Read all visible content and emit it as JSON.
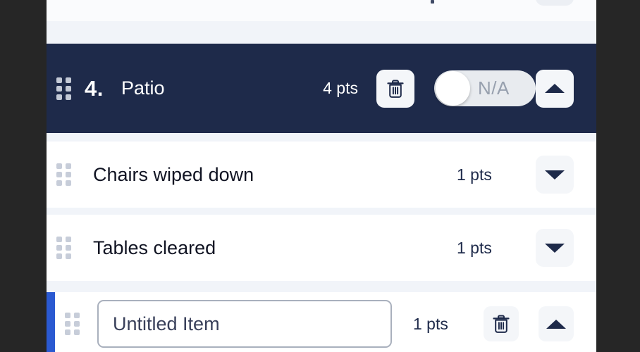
{
  "theme": {
    "page_background": "#262626",
    "panel_background": "#f1f4f9",
    "row_background": "#ffffff",
    "header_navy": "#1e2a4a",
    "accent_blue": "#2a59d1",
    "icon_button_background": "#f4f6f9",
    "toggle_track": "#e8ebef",
    "toggle_label_color": "#97a0ae",
    "input_border": "#a9b0bd"
  },
  "section": {
    "index": "4.",
    "title": "Patio",
    "points": "4 pts",
    "drag_handle_icon": "drag-handle-dots-icon",
    "delete_icon": "trash-icon",
    "toggle": {
      "label": "N/A",
      "state": "off"
    },
    "collapse_icon": "triangle-up-icon"
  },
  "items": [
    {
      "title": "Chairs wiped down",
      "points": "1 pts",
      "drag_handle_icon": "drag-handle-dots-icon",
      "expand_icon": "triangle-down-icon",
      "editing": false
    },
    {
      "title": "Tables cleared",
      "points": "1 pts",
      "drag_handle_icon": "drag-handle-dots-icon",
      "expand_icon": "triangle-down-icon",
      "editing": false
    },
    {
      "title": "Untitled Item",
      "placeholder": "Untitled Item",
      "points": "1 pts",
      "drag_handle_icon": "drag-handle-dots-icon",
      "delete_icon": "trash-icon",
      "collapse_icon": "triangle-up-icon",
      "editing": true
    }
  ]
}
